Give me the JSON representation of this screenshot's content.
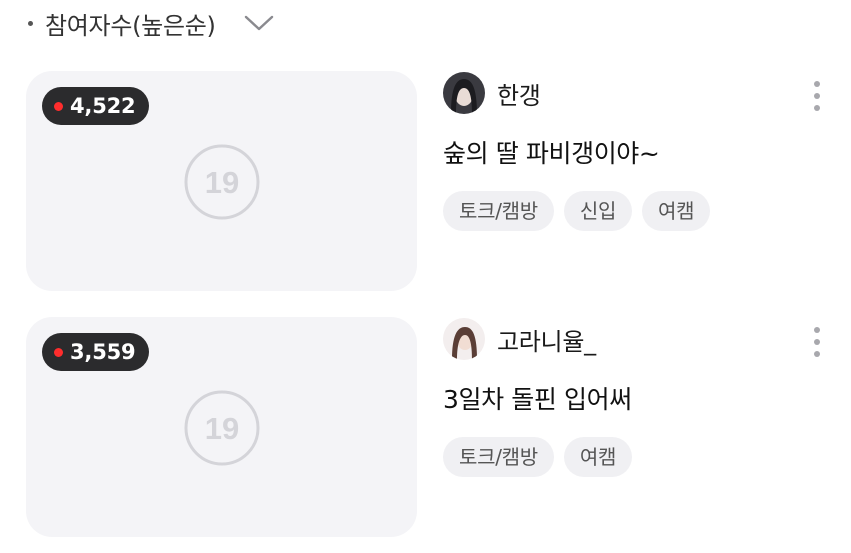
{
  "sort": {
    "label": "참여자수(높은순)",
    "icon": "chevron-down-icon"
  },
  "streams": [
    {
      "viewer_count": "4,522",
      "age_badge": "19",
      "streamer_name": "한갱",
      "title": "숲의 딸 파비갱이야~",
      "tags": [
        "토크/캠방",
        "신입",
        "여캠"
      ]
    },
    {
      "viewer_count": "3,559",
      "age_badge": "19",
      "streamer_name": "고라니율_",
      "title": "3일차 돌핀 입어써",
      "tags": [
        "토크/캠방",
        "여캠"
      ]
    }
  ],
  "colors": {
    "live_dot": "#ff2d2d",
    "badge_bg": "#2b2b2d",
    "thumb_bg": "#f4f4f7",
    "tag_bg": "#f0f0f3"
  }
}
